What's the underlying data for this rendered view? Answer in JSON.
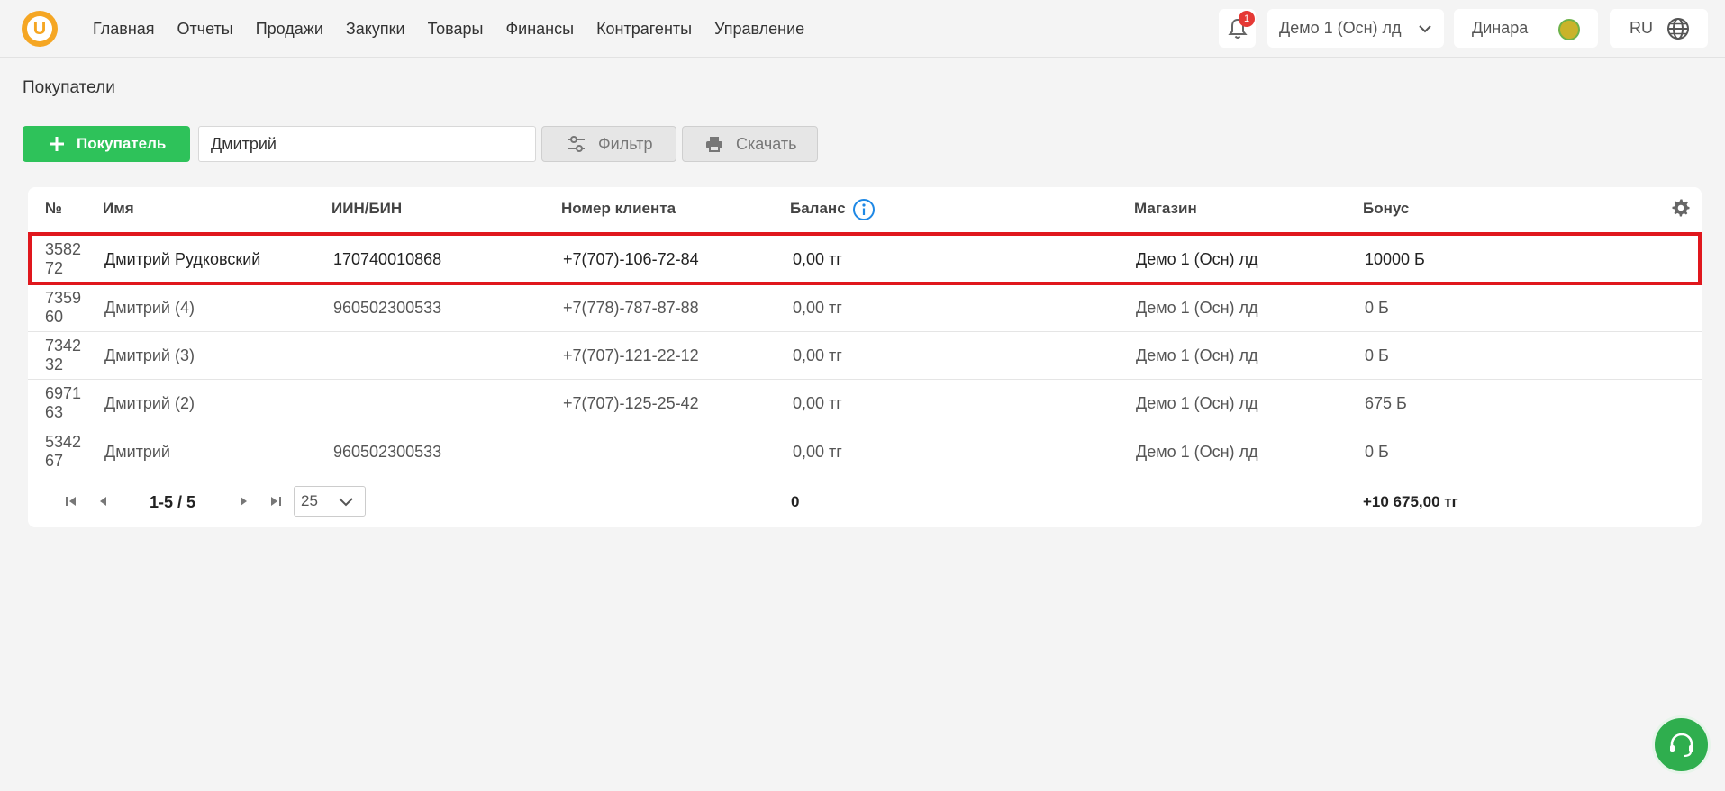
{
  "header": {
    "logo_letter": "U",
    "nav": [
      "Главная",
      "Отчеты",
      "Продажи",
      "Закупки",
      "Товары",
      "Финансы",
      "Контрагенты",
      "Управление"
    ],
    "notifications_count": "1",
    "store": "Демо 1 (Осн) лд",
    "user": "Динара",
    "language": "RU"
  },
  "page": {
    "title": "Покупатели",
    "add_button": "Покупатель",
    "search_value": "Дмитрий",
    "filter_button": "Фильтр",
    "download_button": "Скачать"
  },
  "table": {
    "columns": [
      "№",
      "Имя",
      "ИИН/БИН",
      "Номер клиента",
      "Баланс",
      "Магазин",
      "Бонус"
    ],
    "rows": [
      {
        "id": "358272",
        "name": "Дмитрий Рудковский",
        "iin": "170740010868",
        "phone": "+7(707)-106-72-84",
        "balance": "0,00 тг",
        "store": "Демо 1 (Осн) лд",
        "bonus": "10000 Б"
      },
      {
        "id": "735960",
        "name": "Дмитрий (4)",
        "iin": "960502300533",
        "phone": "+7(778)-787-87-88",
        "balance": "0,00 тг",
        "store": "Демо 1 (Осн) лд",
        "bonus": "0 Б"
      },
      {
        "id": "734232",
        "name": "Дмитрий (3)",
        "iin": "",
        "phone": "+7(707)-121-22-12",
        "balance": "0,00 тг",
        "store": "Демо 1 (Осн) лд",
        "bonus": "0 Б"
      },
      {
        "id": "697163",
        "name": "Дмитрий (2)",
        "iin": "",
        "phone": "+7(707)-125-25-42",
        "balance": "0,00 тг",
        "store": "Демо 1 (Осн) лд",
        "bonus": "675 Б"
      },
      {
        "id": "534267",
        "name": "Дмитрий",
        "iin": "960502300533",
        "phone": "",
        "balance": "0,00 тг",
        "store": "Демо 1 (Осн) лд",
        "bonus": "0 Б"
      }
    ]
  },
  "pagination": {
    "range": "1-5 / 5",
    "page_size": "25",
    "total_balance": "0",
    "total_bonus": "+10 675,00 тг"
  },
  "colors": {
    "accent_green": "#2ec25a",
    "selection_red": "#e0171d",
    "logo_orange": "#f5a623"
  }
}
